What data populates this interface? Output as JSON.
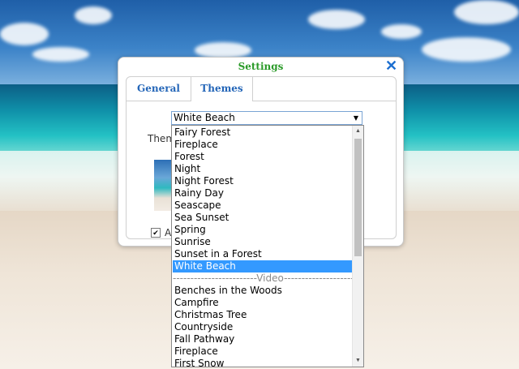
{
  "dialog": {
    "title": "Settings",
    "close_glyph": "✕",
    "tabs": [
      {
        "label": "General",
        "active": false
      },
      {
        "label": "Themes",
        "active": true
      }
    ]
  },
  "themes": {
    "label": "Theme",
    "selected_value": "White Beach",
    "checkbox_label": "Alte",
    "checkbox_checked": true
  },
  "dropdown": {
    "options": [
      {
        "label": "Fairy Forest"
      },
      {
        "label": "Fireplace"
      },
      {
        "label": "Forest"
      },
      {
        "label": "Night"
      },
      {
        "label": "Night Forest"
      },
      {
        "label": "Rainy Day"
      },
      {
        "label": "Seascape"
      },
      {
        "label": "Sea Sunset"
      },
      {
        "label": "Spring"
      },
      {
        "label": "Sunrise"
      },
      {
        "label": "Sunset in a Forest"
      },
      {
        "label": "White Beach",
        "selected": true
      },
      {
        "label": "------------------------Video------------------------",
        "group": true
      },
      {
        "label": "Benches in the Woods"
      },
      {
        "label": "Campfire"
      },
      {
        "label": "Christmas Tree"
      },
      {
        "label": "Countryside"
      },
      {
        "label": "Fall Pathway"
      },
      {
        "label": "Fireplace"
      },
      {
        "label": "First Snow"
      }
    ]
  },
  "icons": {
    "close": "close-icon",
    "select_arrow": "chevron-down-icon",
    "checkbox": "checkmark-icon"
  },
  "colors": {
    "title_green": "#2a9a28",
    "tab_blue": "#2466b8",
    "close_blue": "#1d6fd0",
    "selection_blue": "#3399ff"
  }
}
